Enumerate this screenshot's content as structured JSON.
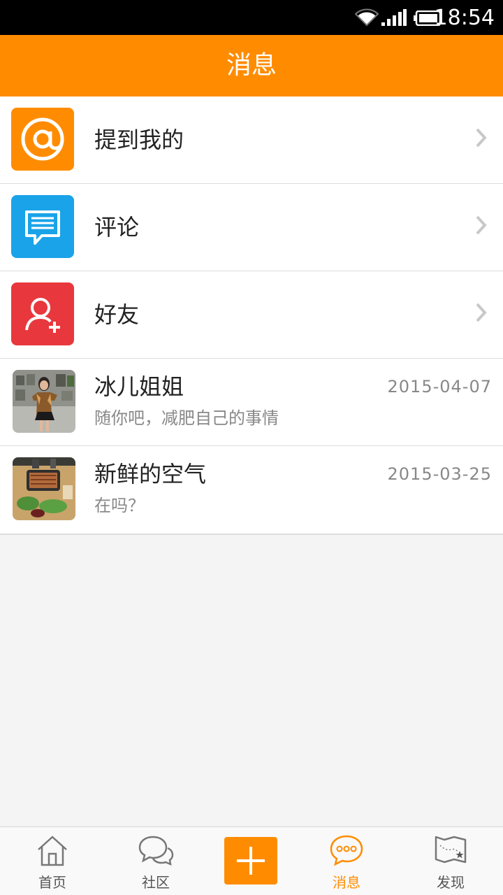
{
  "status_bar": {
    "time": "18:54",
    "icons": [
      "wifi-icon",
      "signal-icon",
      "battery-icon"
    ]
  },
  "header": {
    "title": "消息"
  },
  "menu_items": [
    {
      "label": "提到我的",
      "icon": "at-icon",
      "color": "#ff8c00"
    },
    {
      "label": "评论",
      "icon": "comment-icon",
      "color": "#1aa3e8"
    },
    {
      "label": "好友",
      "icon": "add-friend-icon",
      "color": "#e8383d"
    }
  ],
  "messages": [
    {
      "name": "冰儿姐姐",
      "date": "2015-04-07",
      "preview": "随你吧，减肥自己的事情",
      "avatar": "user-photo"
    },
    {
      "name": "新鲜的空气",
      "date": "2015-03-25",
      "preview": "在吗？",
      "avatar": "food-photo"
    }
  ],
  "tab_bar": {
    "tabs": [
      {
        "label": "首页",
        "icon": "home-icon"
      },
      {
        "label": "社区",
        "icon": "community-icon"
      },
      {
        "label": "",
        "icon": "plus-icon"
      },
      {
        "label": "消息",
        "icon": "message-icon",
        "active": true
      },
      {
        "label": "发现",
        "icon": "map-icon"
      }
    ]
  },
  "colors": {
    "accent": "#ff8c00",
    "blue": "#1aa3e8",
    "red": "#e8383d"
  }
}
